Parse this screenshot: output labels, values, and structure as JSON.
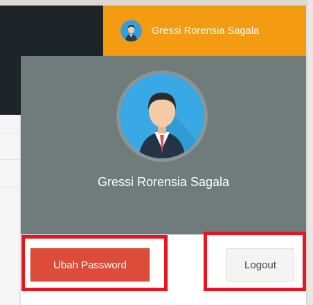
{
  "navbar": {
    "user_name": "Gressi Rorensia Sagala",
    "accent_color": "#f39c12",
    "avatar_icon": "user-avatar-icon"
  },
  "user_menu": {
    "header_name": "Gressi Rorensia Sagala",
    "header_color": "#707b7c",
    "change_password_label": "Ubah Password",
    "logout_label": "Logout"
  },
  "annotations": {
    "highlight_color": "#e8141f"
  }
}
